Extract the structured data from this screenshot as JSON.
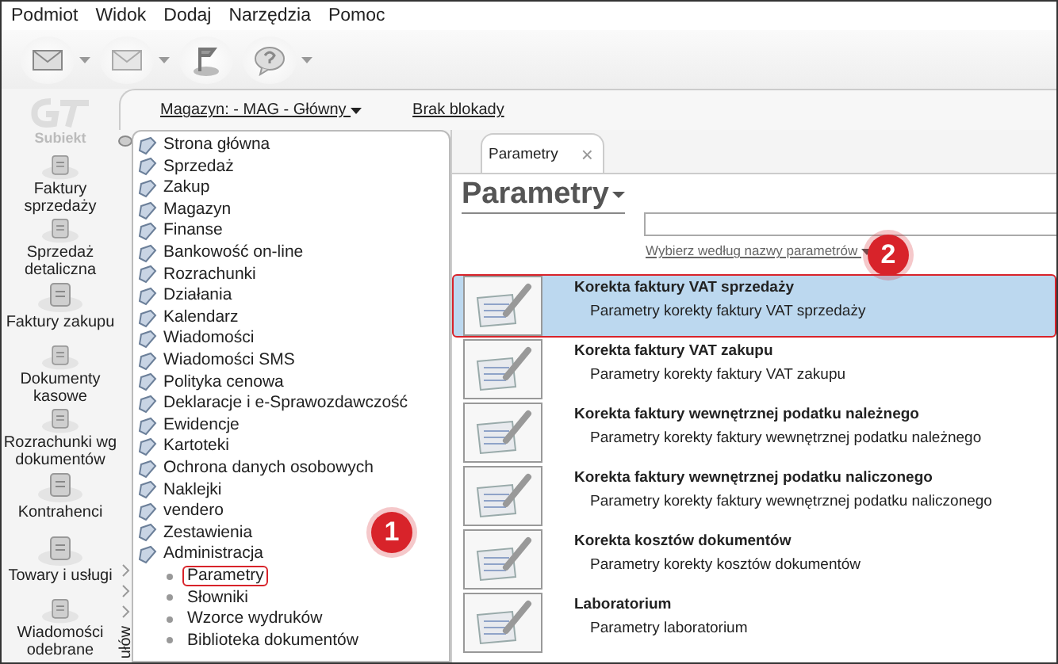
{
  "menu_bar": [
    "Podmiot",
    "Widok",
    "Dodaj",
    "Narzędzia",
    "Pomoc"
  ],
  "toolbar": [
    {
      "kind": "back",
      "dropdown": true
    },
    {
      "kind": "forward",
      "dropdown": true
    },
    {
      "kind": "flag",
      "dropdown": false
    },
    {
      "kind": "help",
      "dropdown": true
    }
  ],
  "logo": {
    "label": "Subiekt"
  },
  "nav": [
    {
      "label": "Faktury sprzedaży"
    },
    {
      "label": "Sprzedaż detaliczna"
    },
    {
      "label": "Faktury zakupu"
    },
    {
      "label": "Dokumenty kasowe"
    },
    {
      "label": "Rozrachunki wg dokumentów"
    },
    {
      "label": "Kontrahenci"
    },
    {
      "label": "Towary i usługi"
    },
    {
      "label": "Wiadomości odebrane"
    }
  ],
  "nav_footer": "ułów",
  "top_bar": {
    "warehouse": "Magazyn: - MAG - Główny",
    "lock": "Brak blokady"
  },
  "tree": [
    {
      "label": "Strona główna"
    },
    {
      "label": "Sprzedaż"
    },
    {
      "label": "Zakup"
    },
    {
      "label": "Magazyn"
    },
    {
      "label": "Finanse"
    },
    {
      "label": "Bankowość on-line"
    },
    {
      "label": "Rozrachunki"
    },
    {
      "label": "Działania"
    },
    {
      "label": "Kalendarz"
    },
    {
      "label": "Wiadomości"
    },
    {
      "label": "Wiadomości SMS"
    },
    {
      "label": "Polityka cenowa"
    },
    {
      "label": "Deklaracje i e-Sprawozdawczość"
    },
    {
      "label": "Ewidencje"
    },
    {
      "label": "Kartoteki"
    },
    {
      "label": "Ochrona danych osobowych"
    },
    {
      "label": "Naklejki"
    },
    {
      "label": "vendero"
    },
    {
      "label": "Zestawienia"
    },
    {
      "label": "Administracja",
      "children": [
        {
          "label": "Parametry",
          "highlighted": true
        },
        {
          "label": "Słowniki",
          "highlighted": false
        },
        {
          "label": "Wzorce wydruków",
          "highlighted": false
        },
        {
          "label": "Biblioteka dokumentów",
          "highlighted": false
        }
      ]
    }
  ],
  "tab": {
    "label": "Parametry",
    "close": "×"
  },
  "heading": "Parametry",
  "filter_link": "Wybierz według nazwy parametrów",
  "items": [
    {
      "title": "Korekta faktury VAT sprzedaży",
      "subtitle": "Parametry korekty faktury VAT sprzedaży",
      "selected": true,
      "highlighted": true
    },
    {
      "title": "Korekta faktury VAT zakupu",
      "subtitle": "Parametry korekty faktury VAT zakupu",
      "selected": false,
      "highlighted": false
    },
    {
      "title": "Korekta faktury wewnętrznej podatku należnego",
      "subtitle": "Parametry korekty faktury wewnętrznej podatku należnego",
      "selected": false,
      "highlighted": false
    },
    {
      "title": "Korekta faktury wewnętrznej podatku naliczonego",
      "subtitle": "Parametry korekty faktury wewnętrznej podatku naliczonego",
      "selected": false,
      "highlighted": false
    },
    {
      "title": "Korekta kosztów dokumentów",
      "subtitle": "Parametry korekty kosztów dokumentów",
      "selected": false,
      "highlighted": false
    },
    {
      "title": "Laboratorium",
      "subtitle": "Parametry laboratorium",
      "selected": false,
      "highlighted": false
    }
  ],
  "annotations": [
    {
      "label": "1"
    },
    {
      "label": "2"
    }
  ]
}
